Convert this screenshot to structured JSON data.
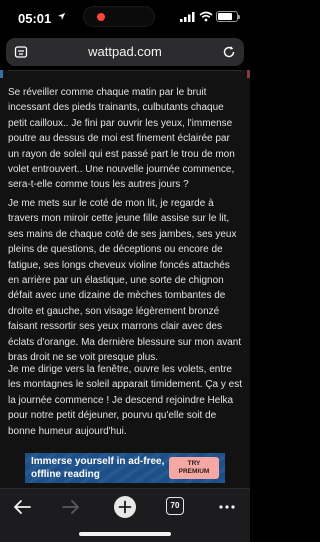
{
  "status_bar": {
    "time": "05:01",
    "battery_level": 0.8
  },
  "browser": {
    "url": "wattpad.com",
    "tab_count": "70"
  },
  "article": {
    "paragraphs": [
      "Se réveiller comme chaque matin par le bruit incessant des pieds trainants, culbutants chaque petit cailloux.. Je fini par ouvrir les yeux, l'immense poutre au dessus de moi est finement éclairée par un rayon de soleil qui est passé part le trou de mon volet entrouvert.. Une nouvelle journée commence, sera-t-elle comme tous les autres jours ?",
      "Je me mets sur le coté de mon lit, je regarde à travers mon miroir cette jeune fille assise sur le lit, ses mains de chaque coté de ses jambes, ses yeux pleins de questions, de déceptions ou encore de fatigue, ses longs cheveux violine foncés attachés en arrière par un élastique, une sorte de chignon défait avec une dizaine de mèches tombantes de droite et gauche, son visage légèrement bronzé faisant ressortir ses yeux marrons clair avec des éclats d'orange. Ma dernière blessure sur mon avant bras droit ne se voit presque plus.",
      "Je me dirige vers la fenêtre, ouvre les volets, entre les montagnes le soleil apparait timidement. Ça y est la journée commence ! Je descend rejoindre Helka pour notre petit déjeuner, pourvu qu'elle soit de bonne humeur aujourd'hui."
    ]
  },
  "ad": {
    "line1": "Immerse yourself in ad-free,",
    "line2": "offline reading",
    "button_line1": "TRY",
    "button_line2": "PREMIUM"
  },
  "colors": {
    "ad_background": "#1d4f88",
    "ad_button": "#f6a8a4",
    "page_background": "#121212"
  }
}
